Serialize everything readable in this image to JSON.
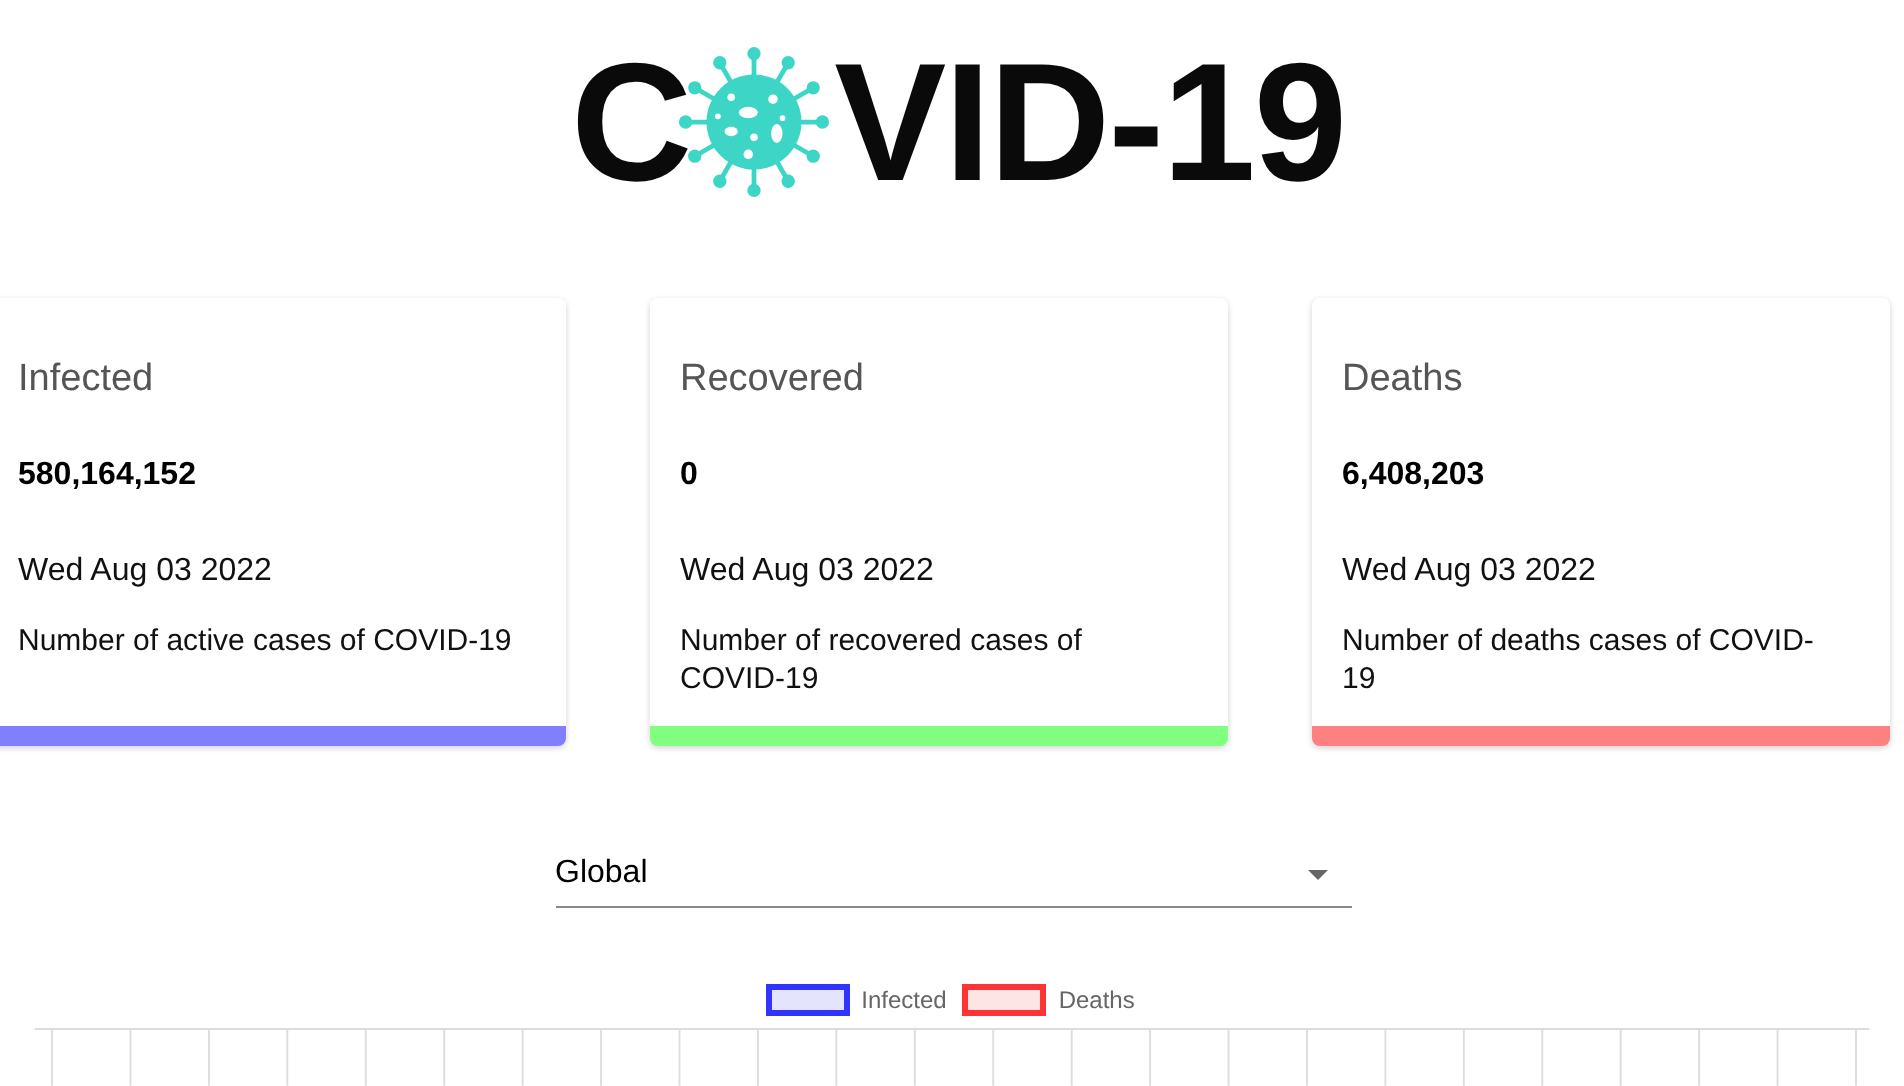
{
  "logo": {
    "before": "C",
    "after": "VID-19"
  },
  "cards": [
    {
      "title": "Infected",
      "value": "580,164,152",
      "date": "Wed Aug 03 2022",
      "description": "Number of active cases of COVID-19",
      "color": "#8080ff"
    },
    {
      "title": "Recovered",
      "value": "0",
      "date": "Wed Aug 03 2022",
      "description": "Number of recovered cases of COVID-19",
      "color": "#80ff80"
    },
    {
      "title": "Deaths",
      "value": "6,408,203",
      "date": "Wed Aug 03 2022",
      "description": "Number of deaths cases of COVID-19",
      "color": "#ff8080"
    }
  ],
  "country_select": {
    "value": "Global"
  },
  "chart": {
    "legend": [
      {
        "label": "Infected",
        "color": "#3333ff"
      },
      {
        "label": "Deaths",
        "color": "#ff3333"
      }
    ]
  }
}
